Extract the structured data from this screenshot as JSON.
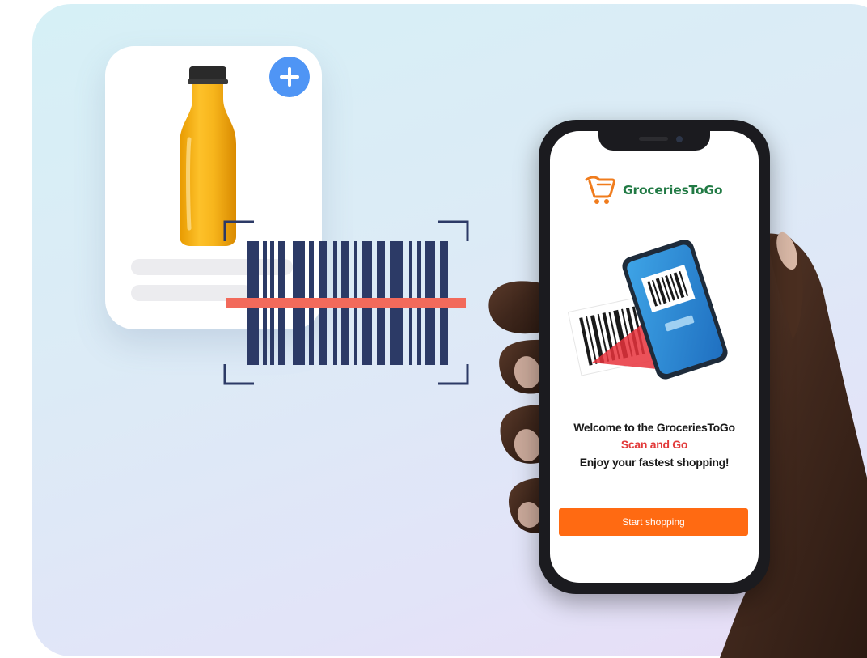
{
  "app": {
    "brand_name": "GroceriesToGo",
    "accent_color": "#ff6a12",
    "brand_color": "#217a44"
  },
  "welcome": {
    "line1": "Welcome to the GroceriesToGo",
    "line2": "Scan and Go",
    "line3": "Enjoy your fastest shopping!"
  },
  "actions": {
    "start_label": "Start shopping"
  },
  "product_card": {
    "add_icon": "plus-circle-icon"
  },
  "scanner": {
    "icon": "barcode-scan-icon",
    "line_color": "#f26a5b"
  }
}
